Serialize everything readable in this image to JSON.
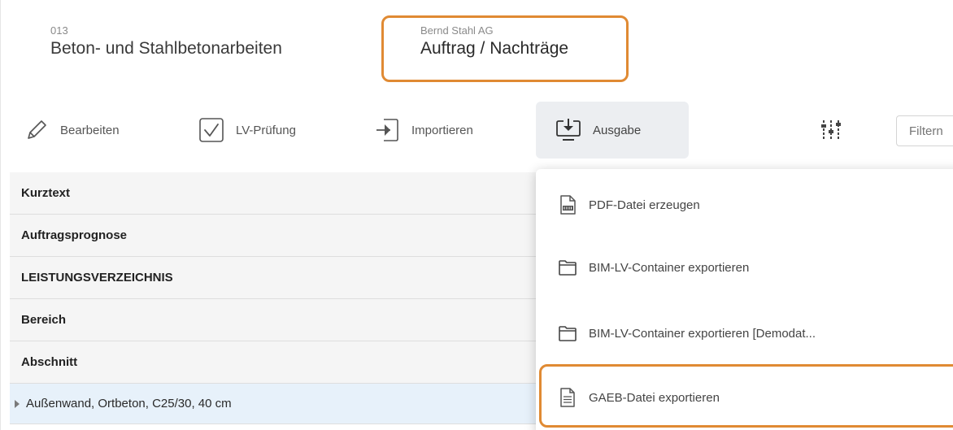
{
  "header": {
    "project_number": "013",
    "project_title": "Beton- und Stahlbetonarbeiten",
    "client_name": "Bernd Stahl AG",
    "contract_title": "Auftrag / Nachträge"
  },
  "toolbar": {
    "edit_label": "Bearbeiten",
    "check_label": "LV-Prüfung",
    "import_label": "Importieren",
    "output_label": "Ausgabe",
    "filter_placeholder": "Filtern"
  },
  "table": {
    "rows": [
      {
        "label": "Kurztext",
        "type": "header"
      },
      {
        "label": "Auftragsprognose",
        "type": "header"
      },
      {
        "label": "LEISTUNGSVERZEICHNIS",
        "type": "header"
      },
      {
        "label": "Bereich",
        "type": "header"
      },
      {
        "label": "Abschnitt",
        "type": "header"
      },
      {
        "label": "Außenwand, Ortbeton, C25/30, 40 cm",
        "type": "data"
      }
    ]
  },
  "output_menu": {
    "items": [
      {
        "label": "PDF-Datei erzeugen",
        "icon": "pdf-file-icon"
      },
      {
        "label": "BIM-LV-Container exportieren",
        "icon": "folder-icon"
      },
      {
        "label": "BIM-LV-Container exportieren [Demodat...",
        "icon": "folder-icon"
      },
      {
        "label": "GAEB-Datei exportieren",
        "icon": "document-icon"
      }
    ]
  },
  "colors": {
    "highlight": "#e08a33",
    "active_button_bg": "#eceef1",
    "selected_row_bg": "#e7f1fa",
    "header_row_bg": "#f5f5f5"
  }
}
